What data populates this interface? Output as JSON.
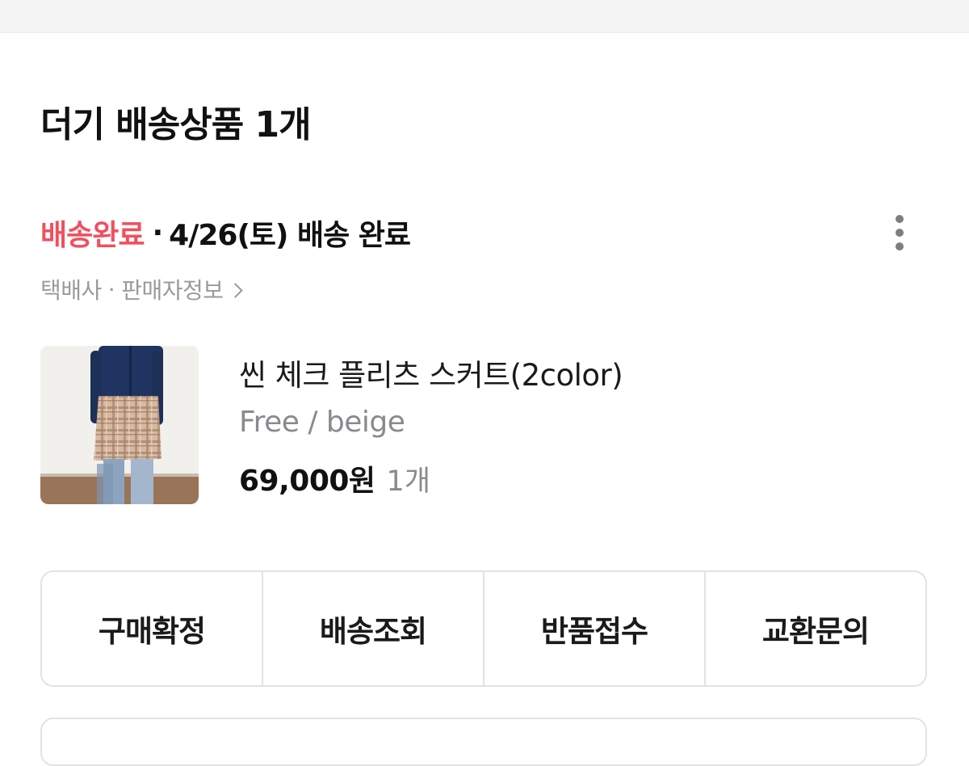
{
  "section": {
    "title": "더기 배송상품 1개"
  },
  "shipment": {
    "status": "배송완료",
    "separator": "·",
    "detail": "4/26(토) 배송 완료",
    "more_icon": "more-vertical-icon"
  },
  "links": {
    "courier": "택배사",
    "separator": "·",
    "seller_info": "판매자정보",
    "chevron_icon": "chevron-right-icon"
  },
  "product": {
    "name": "씬 체크 플리츠 스커트(2color)",
    "option": "Free / beige",
    "price": "69,000원",
    "quantity": "1개"
  },
  "actions": [
    {
      "label": "구매확정"
    },
    {
      "label": "배송조회"
    },
    {
      "label": "반품접수"
    },
    {
      "label": "교환문의"
    }
  ],
  "colors": {
    "status_accent": "#f0505f",
    "muted_text": "#9a9a9e",
    "border": "#e2e2e5"
  }
}
